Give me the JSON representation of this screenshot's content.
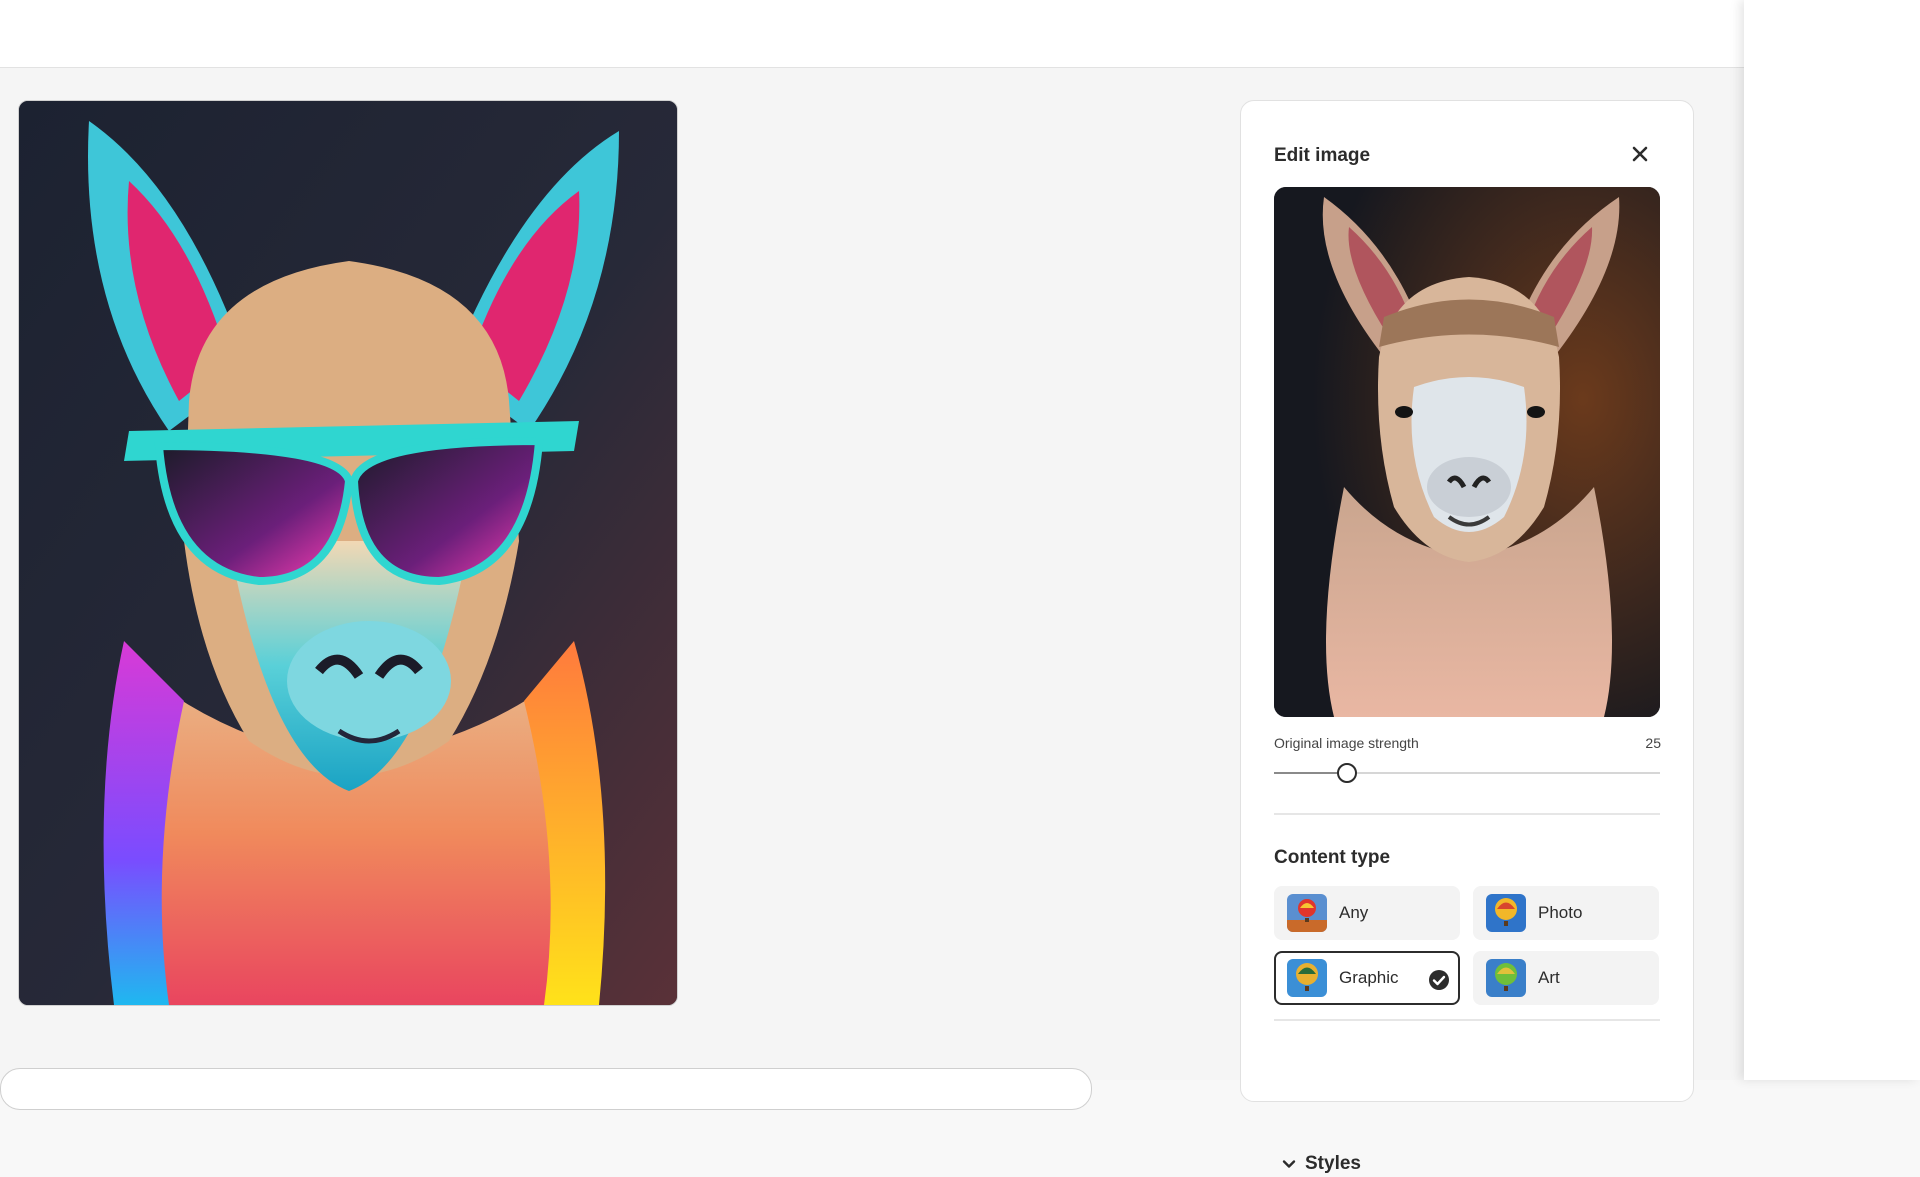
{
  "edit_panel": {
    "title": "Edit image",
    "strength_label": "Original image strength",
    "strength_value": "25",
    "strength_fraction": 0.19,
    "content_type": {
      "heading": "Content type",
      "options": [
        {
          "label": "Any",
          "selected": false
        },
        {
          "label": "Photo",
          "selected": false
        },
        {
          "label": "Graphic",
          "selected": true
        },
        {
          "label": "Art",
          "selected": false
        }
      ]
    },
    "styles_label": "Styles"
  },
  "icons": {
    "close": "close-icon",
    "check": "checkmark-icon",
    "chevron": "chevron-down-icon"
  },
  "colors": {
    "accent": "#2c2c2c",
    "panel_bg": "#ffffff",
    "page_bg": "#f5f5f5"
  }
}
